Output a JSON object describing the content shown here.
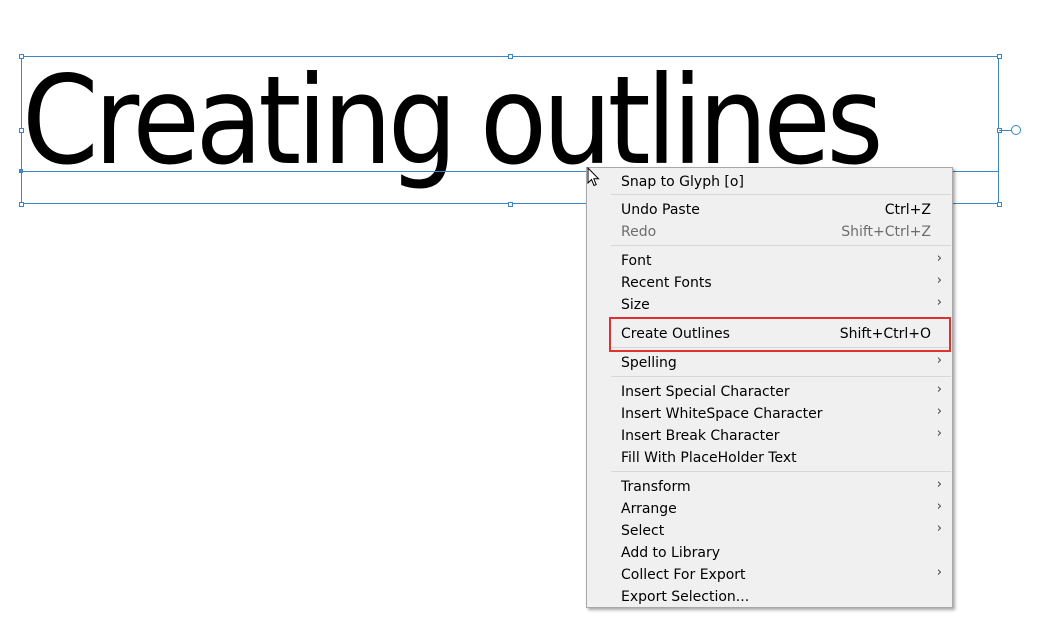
{
  "canvas": {
    "text_object": "Creating outlines"
  },
  "context_menu": {
    "items": [
      {
        "label": "Snap to Glyph [o]",
        "shortcut": "",
        "submenu": false,
        "enabled": true
      },
      {
        "label": "Undo Paste",
        "shortcut": "Ctrl+Z",
        "submenu": false,
        "enabled": true
      },
      {
        "label": "Redo",
        "shortcut": "Shift+Ctrl+Z",
        "submenu": false,
        "enabled": false
      },
      {
        "label": "Font",
        "shortcut": "",
        "submenu": true,
        "enabled": true
      },
      {
        "label": "Recent Fonts",
        "shortcut": "",
        "submenu": true,
        "enabled": true
      },
      {
        "label": "Size",
        "shortcut": "",
        "submenu": true,
        "enabled": true
      },
      {
        "label": "Create Outlines",
        "shortcut": "Shift+Ctrl+O",
        "submenu": false,
        "enabled": true
      },
      {
        "label": "Spelling",
        "shortcut": "",
        "submenu": true,
        "enabled": true
      },
      {
        "label": "Insert Special Character",
        "shortcut": "",
        "submenu": true,
        "enabled": true
      },
      {
        "label": "Insert WhiteSpace Character",
        "shortcut": "",
        "submenu": true,
        "enabled": true
      },
      {
        "label": "Insert Break Character",
        "shortcut": "",
        "submenu": true,
        "enabled": true
      },
      {
        "label": "Fill With PlaceHolder Text",
        "shortcut": "",
        "submenu": false,
        "enabled": true
      },
      {
        "label": "Transform",
        "shortcut": "",
        "submenu": true,
        "enabled": true
      },
      {
        "label": "Arrange",
        "shortcut": "",
        "submenu": true,
        "enabled": true
      },
      {
        "label": "Select",
        "shortcut": "",
        "submenu": true,
        "enabled": true
      },
      {
        "label": "Add to Library",
        "shortcut": "",
        "submenu": false,
        "enabled": true
      },
      {
        "label": "Collect For Export",
        "shortcut": "",
        "submenu": true,
        "enabled": true
      },
      {
        "label": "Export Selection...",
        "shortcut": "",
        "submenu": false,
        "enabled": true
      }
    ],
    "submenu_glyph": "›"
  },
  "colors": {
    "selection": "#3a86c8",
    "highlight_box": "#e03030",
    "menu_bg": "#f0f0f0",
    "disabled_text": "#6d6d6d"
  }
}
